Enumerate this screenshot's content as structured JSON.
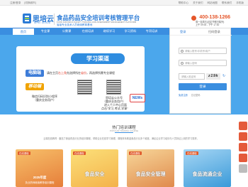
{
  "topbar": {
    "left": [
      "注册/登录",
      "[切换城市]"
    ],
    "right": [
      "帮助中心",
      "关于我们",
      "网站地图",
      "联系我们",
      "手机版"
    ]
  },
  "header": {
    "logo_text": "思培云",
    "logo_sub": "SIPEI CLOUD",
    "brand_title": "食品药品安全培训考核管理平台",
    "brand_en": "FOOD AND DRUG SAFETY TRAINING AND ASSESSMENT MANAGEMENT PLATFORM",
    "brand_sub": "省级专业技术人员继续教育基地",
    "phone": "400-138-1266",
    "hours_1": "周一至周五(法定节假日除外)",
    "hours_2": "上午 09:00 - 下午 17:30"
  },
  "nav": {
    "items": [
      "首页",
      "专业课",
      "公需课",
      "在线培训",
      "继续学习",
      "学习资料",
      "专项培训",
      "主持机构"
    ]
  },
  "banner": {
    "tag": "学习渠道",
    "pc_label": "电脑端",
    "pc_text_a": "请在主页",
    "pc_text_red": "右上角",
    "pc_text_b": "先选择所在",
    "pc_text_red2": "省份",
    "pc_text_c": "，再选择所需专业课程",
    "mb_label": "移动端",
    "wechat_a": "微信扫码识别小程序",
    "wechat_b": "（重庆业务用户）",
    "gzh_a": "思培云公众号",
    "gzh_b": "（重庆业务用户）",
    "gzh_c": "进入个人中心页面",
    "gzh_d": "点击\"学习-考试-学课\"",
    "news": "NEWs"
  },
  "login": {
    "tab_login": "登录",
    "tab_scan": "扫码登录",
    "username_placeholder": "请输入账号/手机号/用户",
    "password_placeholder": "请输入密码",
    "captcha_placeholder": "请输入验证码",
    "captcha_code": "z19k",
    "refresh": "换一张",
    "button": "登录",
    "link_register": "免费注册",
    "link_forgot": "忘记密码",
    "link_other": "还没有账号 注册账号"
  },
  "section": {
    "title": "热门培训课程",
    "subtitle": "POPULAR TRAINING COURSE",
    "intro": "云端在线教育 · 囊括了食品药品行业的培训课程，帮助企业在线学习管理，课程体系覆盖食品行业多个维度，满足企业学习培训与人员持证上岗的学习需求。"
  },
  "courses": [
    {
      "badge": "在线课程",
      "label": "",
      "title": "2025年度",
      "subtitle": "执业药师继续教育培训课程",
      "color": "#e67e3a"
    },
    {
      "badge": "在线课程",
      "label": "食品安全",
      "title": "",
      "subtitle": "",
      "color": "#f4b24a"
    },
    {
      "badge": "在线课程",
      "label": "食品安全管理",
      "title": "",
      "subtitle": "",
      "color": "#e08a4c"
    },
    {
      "badge": "在线课程",
      "label": "食品流通企业",
      "title": "",
      "subtitle": "",
      "color": "#3a9ad9"
    }
  ]
}
